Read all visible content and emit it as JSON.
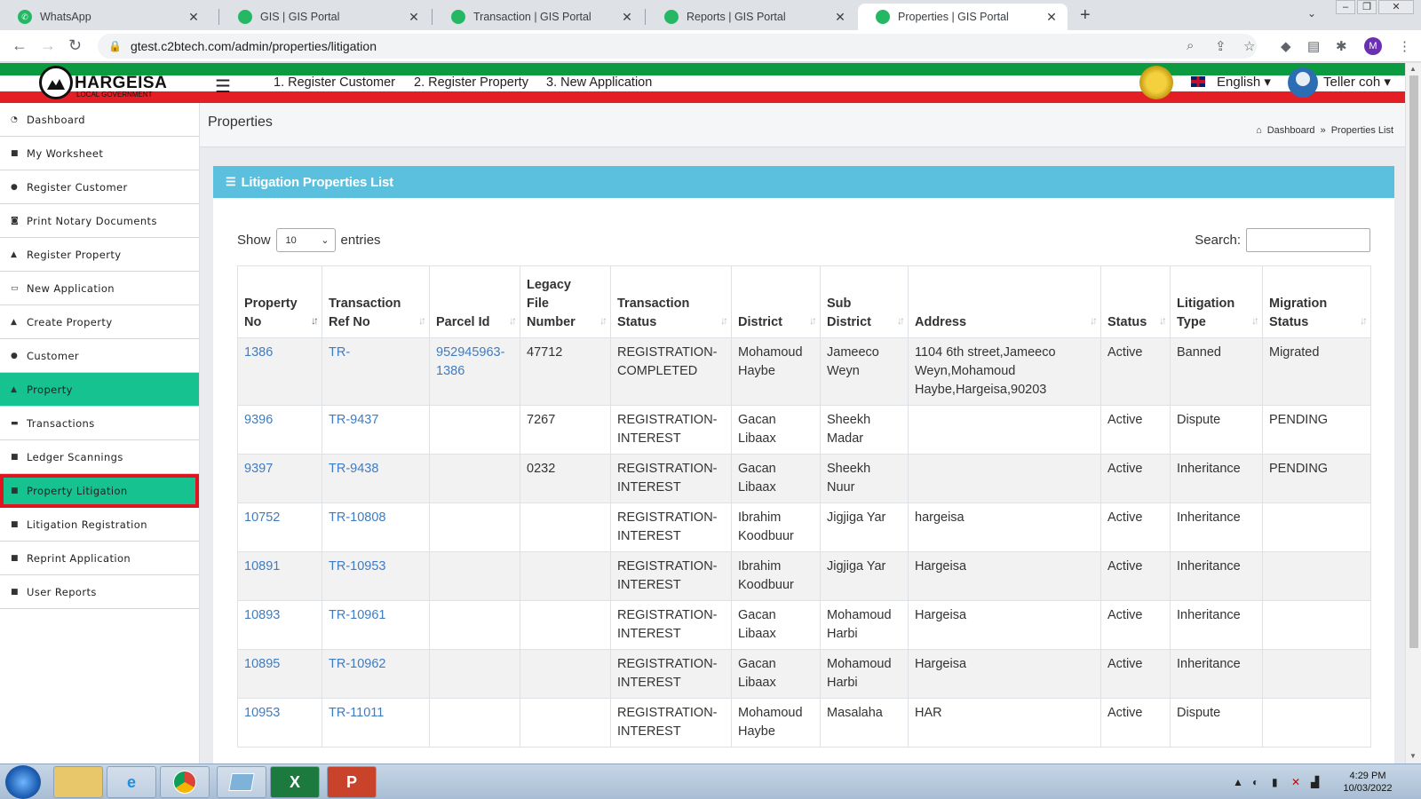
{
  "browser": {
    "tabs": [
      {
        "title": "WhatsApp",
        "icon": "whatsapp-icon",
        "active": false
      },
      {
        "title": "GIS | GIS Portal",
        "icon": "gis-favicon-icon",
        "active": false
      },
      {
        "title": "Transaction | GIS Portal",
        "icon": "gis-favicon-icon",
        "active": false
      },
      {
        "title": "Reports | GIS Portal",
        "icon": "gis-favicon-icon",
        "active": false
      },
      {
        "title": "Properties | GIS Portal",
        "icon": "gis-favicon-icon",
        "active": true
      }
    ],
    "url": "gtest.c2btech.com/admin/properties/litigation",
    "profile_initial": "M"
  },
  "header": {
    "brand": "HARGEISA",
    "brand_sub": "LOCAL GOVERNMENT",
    "logo_letters": "D H A",
    "nav": [
      "1. Register Customer",
      "2. Register Property",
      "3. New Application"
    ],
    "language": "English",
    "user": "Teller coh",
    "colors": {
      "green": "#0b9a3f",
      "red": "#e31e24",
      "accent": "#16c28f",
      "panel": "#5bc0de",
      "highlight_border": "#e0141e"
    }
  },
  "sidebar": {
    "items": [
      {
        "label": "Dashboard",
        "icon": "dashboard-icon",
        "state": "normal"
      },
      {
        "label": "My Worksheet",
        "icon": "book-icon",
        "state": "normal"
      },
      {
        "label": "Register Customer",
        "icon": "user-icon",
        "state": "normal"
      },
      {
        "label": "Print Notary Documents",
        "icon": "print-icon",
        "state": "normal"
      },
      {
        "label": "Register Property",
        "icon": "home-icon",
        "state": "normal"
      },
      {
        "label": "New Application",
        "icon": "monitor-icon",
        "state": "normal"
      },
      {
        "label": "Create Property",
        "icon": "home-icon",
        "state": "normal"
      },
      {
        "label": "Customer",
        "icon": "user-icon",
        "state": "normal"
      },
      {
        "label": "Property",
        "icon": "home-icon",
        "state": "active"
      },
      {
        "label": "Transactions",
        "icon": "money-icon",
        "state": "normal"
      },
      {
        "label": "Ledger Scannings",
        "icon": "book-icon",
        "state": "normal"
      },
      {
        "label": "Property Litigation",
        "icon": "book-icon",
        "state": "highlight"
      },
      {
        "label": "Litigation Registration",
        "icon": "book-icon",
        "state": "normal"
      },
      {
        "label": "Reprint Application",
        "icon": "book-icon",
        "state": "normal"
      },
      {
        "label": "User Reports",
        "icon": "book-icon",
        "state": "normal"
      }
    ]
  },
  "page": {
    "title": "Properties",
    "breadcrumb": {
      "home": "Dashboard",
      "sep": "»",
      "current": "Properties List"
    },
    "panel_title": "Litigation Properties List",
    "show_label": "Show",
    "entries_value": "10",
    "entries_label": "entries",
    "search_label": "Search:",
    "search_value": ""
  },
  "table": {
    "columns": [
      "Property No",
      "Transaction Ref No",
      "Parcel Id",
      "Legacy File Number",
      "Transaction Status",
      "District",
      "Sub District",
      "Address",
      "Status",
      "Litigation Type",
      "Migration Status"
    ],
    "rows": [
      [
        "1386",
        "TR-",
        "952945963-1386",
        "47712",
        "REGISTRATION-COMPLETED",
        "Mohamoud Haybe",
        "Jameeco Weyn",
        "1104 6th street,Jameeco Weyn,Mohamoud Haybe,Hargeisa,90203",
        "Active",
        "Banned",
        "Migrated"
      ],
      [
        "9396",
        "TR-9437",
        "",
        "7267",
        "REGISTRATION-INTEREST",
        "Gacan Libaax",
        "Sheekh Madar",
        "",
        "Active",
        "Dispute",
        "PENDING"
      ],
      [
        "9397",
        "TR-9438",
        "",
        "0232",
        "REGISTRATION-INTEREST",
        "Gacan Libaax",
        "Sheekh Nuur",
        "",
        "Active",
        "Inheritance",
        "PENDING"
      ],
      [
        "10752",
        "TR-10808",
        "",
        "",
        "REGISTRATION-INTEREST",
        "Ibrahim Koodbuur",
        "Jigjiga Yar",
        "hargeisa",
        "Active",
        "Inheritance",
        ""
      ],
      [
        "10891",
        "TR-10953",
        "",
        "",
        "REGISTRATION-INTEREST",
        "Ibrahim Koodbuur",
        "Jigjiga Yar",
        "Hargeisa",
        "Active",
        "Inheritance",
        ""
      ],
      [
        "10893",
        "TR-10961",
        "",
        "",
        "REGISTRATION-INTEREST",
        "Gacan Libaax",
        "Mohamoud Harbi",
        "Hargeisa",
        "Active",
        "Inheritance",
        ""
      ],
      [
        "10895",
        "TR-10962",
        "",
        "",
        "REGISTRATION-INTEREST",
        "Gacan Libaax",
        "Mohamoud Harbi",
        "Hargeisa",
        "Active",
        "Inheritance",
        ""
      ],
      [
        "10953",
        "TR-11011",
        "",
        "",
        "REGISTRATION-INTEREST",
        "Mohamoud Haybe",
        "Masalaha",
        "HAR",
        "Active",
        "Dispute",
        ""
      ]
    ]
  },
  "taskbar": {
    "apps": [
      "file-explorer-icon",
      "edge-icon",
      "chrome-icon",
      "notepad-icon",
      "excel-icon",
      "powerpoint-icon"
    ],
    "time": "4:29 PM",
    "date": "10/03/2022"
  }
}
